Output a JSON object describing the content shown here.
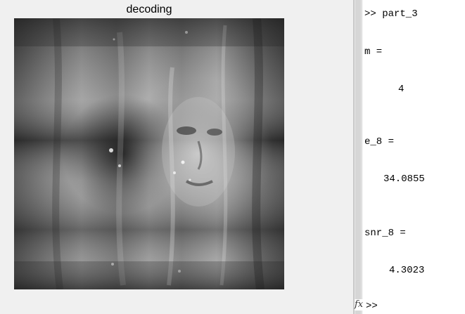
{
  "figure": {
    "title": "decoding"
  },
  "command_window": {
    "lines": {
      "command": ">> part_3",
      "m_label": "m =",
      "m_value": "4",
      "e8_label": "e_8 =",
      "e8_value": "34.0855",
      "snr8_label": "snr_8 =",
      "snr8_value": "4.3023",
      "prompt": ">>"
    }
  },
  "icons": {
    "function_browser": "fx-icon"
  }
}
